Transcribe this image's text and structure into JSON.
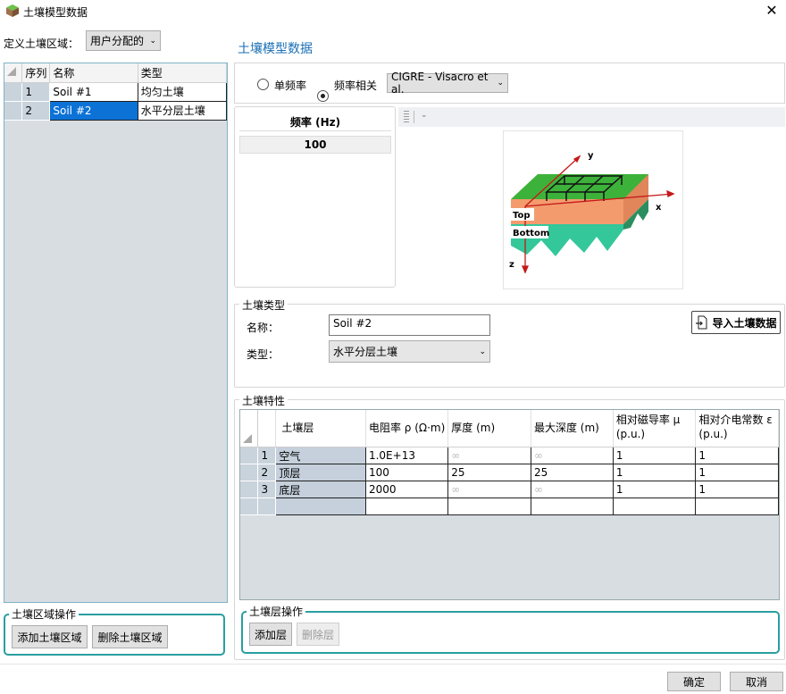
{
  "window": {
    "title": "土壤模型数据",
    "close_glyph": "✕"
  },
  "region": {
    "label": "定义土壤区域：",
    "mode_value": "用户分配的"
  },
  "soil_grid": {
    "headers": [
      "序列",
      "名称",
      "类型"
    ],
    "rows": [
      {
        "index": "1",
        "name": "Soil #1",
        "type": "均匀土壤"
      },
      {
        "index": "2",
        "name": "Soil #2",
        "type": "水平分层土壤"
      }
    ]
  },
  "region_ops": {
    "title": "土壤区域操作",
    "add_label": "添加土壤区域",
    "delete_label": "删除土壤区域"
  },
  "main": {
    "title": "土壤模型数据",
    "freq_mode": {
      "single_label": "单频率",
      "dependent_label": "频率相关",
      "selected": "dependent",
      "model_value": "CIGRE - Visacro et al."
    },
    "freq_table": {
      "header": "频率 (Hz)",
      "value": "100"
    },
    "diagram": {
      "axis_x": "x",
      "axis_y": "y",
      "axis_z": "z",
      "top_label": "Top",
      "bottom_label": "Bottom"
    }
  },
  "soil_type": {
    "title": "土壤类型",
    "name_label": "名称：",
    "name_value": "Soil #2",
    "type_label": "类型：",
    "type_value": "水平分层土壤",
    "import_label": "导入土壤数据"
  },
  "soil_props": {
    "title": "土壤特性",
    "headers": [
      "土壤层",
      "电阻率 ρ (Ω·m)",
      "厚度 (m)",
      "最大深度 (m)",
      "相对磁导率 μ\n(p.u.)",
      "相对介电常数 ε\n(p.u.)"
    ],
    "rows": [
      {
        "index": "1",
        "layer": "空气",
        "resistivity": "1.0E+13",
        "thickness": "∞",
        "max_depth": "∞",
        "mu": "1",
        "eps": "1"
      },
      {
        "index": "2",
        "layer": "顶层",
        "resistivity": "100",
        "thickness": "25",
        "max_depth": "25",
        "mu": "1",
        "eps": "1"
      },
      {
        "index": "3",
        "layer": "底层",
        "resistivity": "2000",
        "thickness": "∞",
        "max_depth": "∞",
        "mu": "1",
        "eps": "1"
      }
    ]
  },
  "layer_ops": {
    "title": "土壤层操作",
    "add_label": "添加层",
    "delete_label": "删除层"
  },
  "footer": {
    "ok_label": "确定",
    "cancel_label": "取消"
  },
  "colors": {
    "accent_title": "#1a6fb5",
    "selection": "#0c72d6",
    "teal_border": "#2a9ea0"
  }
}
